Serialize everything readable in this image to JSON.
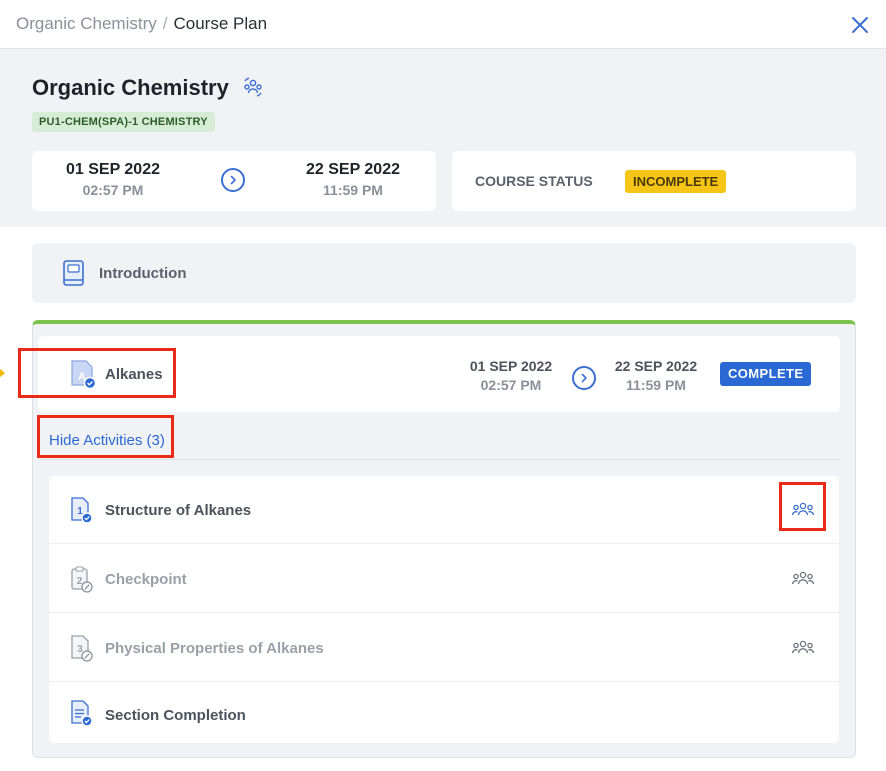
{
  "breadcrumb": {
    "parent": "Organic Chemistry",
    "separator": "/",
    "current": "Course Plan"
  },
  "course": {
    "title": "Organic Chemistry",
    "code": "PU1-CHEM(SPA)-1 CHEMISTRY",
    "start_date": "01 SEP 2022",
    "start_time": "02:57 PM",
    "end_date": "22 SEP 2022",
    "end_time": "11:59 PM",
    "status_label": "COURSE STATUS",
    "status_value": "INCOMPLETE"
  },
  "intro": {
    "label": "Introduction"
  },
  "section": {
    "label": "Alkanes",
    "icon_letter": "A",
    "start_date": "01 SEP 2022",
    "start_time": "02:57 PM",
    "end_date": "22 SEP 2022",
    "end_time": "11:59 PM",
    "status": "COMPLETE",
    "hide_activities": "Hide Activities (3)"
  },
  "activities": [
    {
      "label": "Structure of Alkanes",
      "number": "1",
      "state": "complete",
      "group_icon": "group-icon"
    },
    {
      "label": "Checkpoint",
      "number": "2",
      "state": "pending",
      "group_icon": "group-icon"
    },
    {
      "label": "Physical Properties of Alkanes",
      "number": "3",
      "state": "pending",
      "group_icon": "group-icon"
    },
    {
      "label": "Section Completion",
      "number": "",
      "state": "complete",
      "group_icon": ""
    }
  ],
  "colors": {
    "accent": "#2a68d4",
    "complete_green": "#7cc24a",
    "incomplete_yellow": "#f5c518",
    "highlight_red": "#ea2a16"
  }
}
